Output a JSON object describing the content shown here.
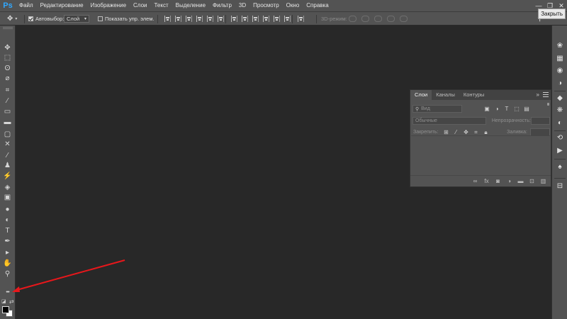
{
  "app": {
    "logo": "Ps"
  },
  "menu": [
    "Файл",
    "Редактирование",
    "Изображение",
    "Слои",
    "Текст",
    "Выделение",
    "Фильтр",
    "3D",
    "Просмотр",
    "Окно",
    "Справка"
  ],
  "window_controls": {
    "minimize": "—",
    "restore": "❐",
    "close": "✕"
  },
  "tooltip": "Закрыть",
  "options_bar": {
    "auto_select_label": "Автовыбор:",
    "auto_select_checked": true,
    "auto_select_value": "Слой",
    "show_transform_label": "Показать упр. элем.",
    "show_transform_checked": false,
    "mode_3d_label": "3D-режим:"
  },
  "tools": [
    {
      "name": "move-tool",
      "glyph": "✥"
    },
    {
      "name": "marquee-tool",
      "glyph": "⬚"
    },
    {
      "name": "lasso-tool",
      "glyph": "ʘ"
    },
    {
      "name": "quick-select-tool",
      "glyph": "⌀"
    },
    {
      "name": "crop-tool",
      "glyph": "⌗"
    },
    {
      "name": "eyedropper-tool",
      "glyph": "⁄"
    },
    {
      "name": "healing-tool",
      "glyph": "▭"
    },
    {
      "name": "ruler-tool",
      "glyph": "▬"
    },
    {
      "name": "frame-tool",
      "glyph": "▢"
    },
    {
      "name": "patch-tool",
      "glyph": "✕"
    },
    {
      "name": "brush-tool",
      "glyph": "⁄"
    },
    {
      "name": "clone-stamp-tool",
      "glyph": "♟"
    },
    {
      "name": "history-brush-tool",
      "glyph": "⚡"
    },
    {
      "name": "eraser-tool",
      "glyph": "◈"
    },
    {
      "name": "gradient-tool",
      "glyph": "▣"
    },
    {
      "name": "blur-tool",
      "glyph": "●"
    },
    {
      "name": "dodge-tool",
      "glyph": "◐"
    },
    {
      "name": "type-tool",
      "glyph": "T"
    },
    {
      "name": "pen-tool",
      "glyph": "✒"
    },
    {
      "name": "path-select-tool",
      "glyph": "▸"
    },
    {
      "name": "hand-tool",
      "glyph": "✋"
    },
    {
      "name": "zoom-tool",
      "glyph": "⚲"
    },
    {
      "name": "more-tools",
      "glyph": "•••"
    }
  ],
  "dock_icons": [
    {
      "name": "libraries-icon",
      "glyph": "❀"
    },
    {
      "name": "color-icon",
      "glyph": "▦"
    },
    {
      "name": "swatches-icon",
      "glyph": "◉"
    },
    {
      "name": "adjustments-icon",
      "glyph": "◑"
    },
    {
      "name": "layers-icon",
      "glyph": "◆"
    },
    {
      "name": "channels-icon",
      "glyph": "❋"
    },
    {
      "name": "paths-icon",
      "glyph": "◐"
    },
    {
      "name": "history-icon",
      "glyph": "⟲"
    },
    {
      "name": "actions-icon",
      "glyph": "▶"
    },
    {
      "name": "brush-settings-icon",
      "glyph": "♠"
    },
    {
      "name": "properties-icon",
      "glyph": "⊟"
    }
  ],
  "layers_panel": {
    "tabs": [
      "Слои",
      "Каналы",
      "Контуры"
    ],
    "active_tab": 0,
    "collapse": "»",
    "filter_placeholder": "Вид",
    "blend_mode": "Обычные",
    "opacity_label": "Непрозрачность:",
    "lock_label": "Закрепить:",
    "fill_label": "Заливка:"
  },
  "colors": {
    "foreground": "#000000",
    "background": "#ffffff",
    "annotation_arrow": "#e8171b",
    "ps_logo": "#31a8ff"
  }
}
